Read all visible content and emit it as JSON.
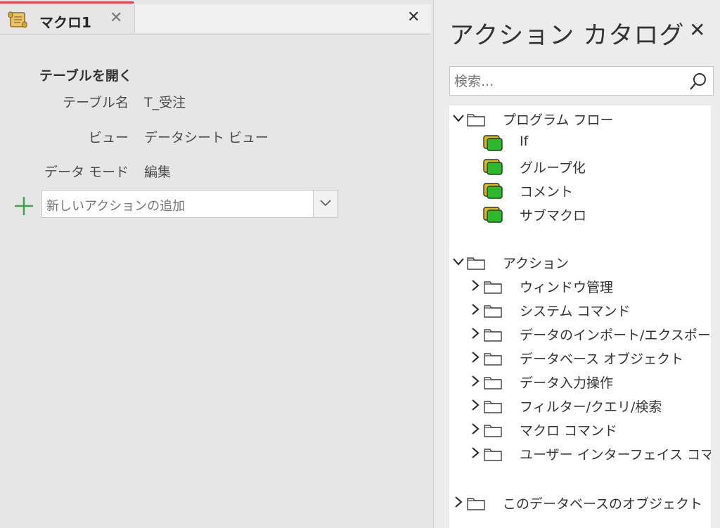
{
  "tab": {
    "label": "マクロ1",
    "close": "✕"
  },
  "pane_close": "✕",
  "action": {
    "title": "テーブルを開く",
    "args": [
      {
        "label": "テーブル名",
        "value": "T_受注"
      },
      {
        "label": "ビュー",
        "value": "データシート ビュー"
      },
      {
        "label": "データ モード",
        "value": "編集"
      }
    ]
  },
  "add_action": {
    "placeholder": "新しいアクションの追加"
  },
  "catalog": {
    "title": "アクション カタログ",
    "close": "✕",
    "search_placeholder": "検索...",
    "program_flow": {
      "label": "プログラム フロー",
      "items": [
        "If",
        "グループ化",
        "コメント",
        "サブマクロ"
      ]
    },
    "actions": {
      "label": "アクション",
      "items": [
        "ウィンドウ管理",
        "システム コマンド",
        "データのインポート/エクスポート",
        "データベース オブジェクト",
        "データ入力操作",
        "フィルター/クエリ/検索",
        "マクロ コマンド",
        "ユーザー インターフェイス コマンド"
      ]
    },
    "db_objects": {
      "label": "このデータベースのオブジェクト"
    }
  },
  "colors": {
    "tab_accent": "#d9464b",
    "plus_green": "#3fa34d",
    "flow_icon_green": "#2db82d",
    "flow_icon_yellow": "#d8c200"
  }
}
